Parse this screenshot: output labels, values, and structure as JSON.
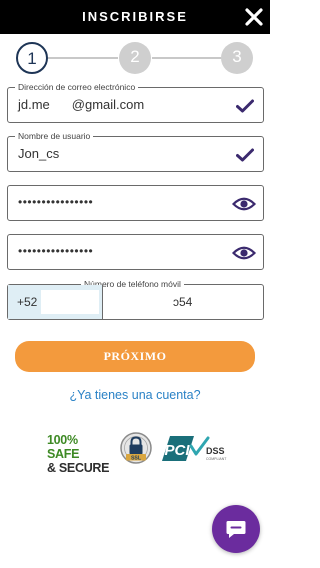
{
  "header": {
    "title": "INSCRIBIRSE",
    "close_icon": "close-icon"
  },
  "stepper": {
    "steps": [
      "1",
      "2",
      "3"
    ],
    "active": 1
  },
  "form": {
    "email": {
      "label": "Dirección de correo electrónico",
      "value_start": "jd.me",
      "value_end": "@gmail.com",
      "status_icon": "check-icon"
    },
    "username": {
      "label": "Nombre de usuario",
      "value": "Jon_cs",
      "status_icon": "check-icon"
    },
    "password": {
      "value": "••••••••••••••••",
      "toggle_icon": "eye-icon"
    },
    "password_confirm": {
      "value": "••••••••••••••••",
      "toggle_icon": "eye-icon"
    },
    "phone": {
      "label": "Número de teléfono móvil",
      "country_code": "+52",
      "number": "ɔ54"
    }
  },
  "actions": {
    "next_label": "PRÓXIMO",
    "login_link": "¿Ya tienes una cuenta?"
  },
  "badges": {
    "safe_line1": "100% SAFE",
    "safe_line2": "& SECURE",
    "ssl": "SSL",
    "pci": "PCI",
    "dss": "DSS",
    "compliant": "COMPLIANT"
  },
  "chat": {
    "icon": "chat-icon"
  },
  "colors": {
    "header_bg": "#000000",
    "accent_navy": "#1e3556",
    "check_purple": "#3b2a6e",
    "button_orange": "#f39a3d",
    "link_blue": "#2a82c6",
    "chat_purple": "#6b2c9e",
    "safe_green": "#3e8a25",
    "pci_teal": "#1a6f7a"
  }
}
